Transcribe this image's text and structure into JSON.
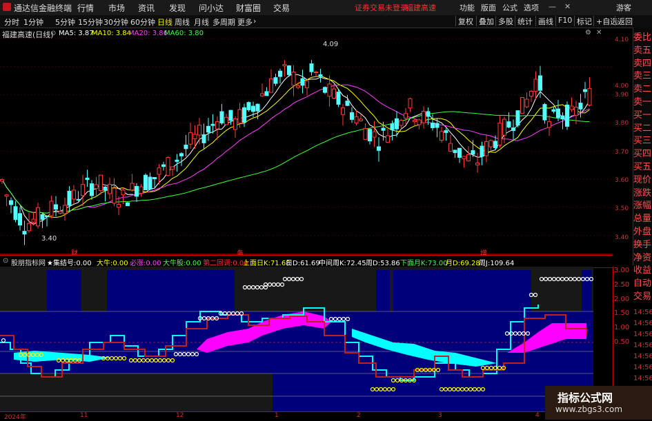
{
  "app": {
    "title": "通达信金融终端",
    "alert1": "证券交易未登录",
    "alert2": "福建高速"
  },
  "menu": [
    "行情",
    "市场",
    "资讯",
    "发现",
    "问小达",
    "财富圈",
    "交易"
  ],
  "sysbtns": [
    "功能",
    "版面",
    "公式",
    "选项",
    "游客"
  ],
  "periods": [
    "分时",
    "1分钟",
    "5分钟",
    "15分钟",
    "30分钟",
    "60分钟",
    "日线",
    "周线",
    "月线",
    "多周期",
    "更多"
  ],
  "active_period": "日线",
  "right_tools": [
    "复权",
    "叠加",
    "多股",
    "统计",
    "画线",
    "F10",
    "标记",
    "+自选",
    "返回"
  ],
  "stock": {
    "name": "福建高速(日线)",
    "ma5": "MA5: 3.87",
    "ma10": "MA10: 3.84",
    "ma20": "MA20: 3.86",
    "ma60": "MA60: 3.80",
    "high": "4.09",
    "low": "3.40"
  },
  "colors": {
    "up": "#ff3b3b",
    "down": "#54ffff",
    "ma5": "#ffffff",
    "ma10": "#ffff00",
    "ma20": "#ff40ff",
    "ma60": "#40ff40"
  },
  "price_ticks": [
    "4.10",
    "4.00",
    "3.90",
    "3.80",
    "3.70",
    "3.60",
    "3.50",
    "3.40"
  ],
  "events": [
    "财",
    "务",
    "增"
  ],
  "right_panel": [
    "委比",
    "卖五",
    "卖四",
    "卖三",
    "卖二",
    "卖一",
    "买一",
    "买二",
    "买三",
    "买四",
    "买五",
    "现价",
    "涨跌",
    "涨幅",
    "总量",
    "外盘",
    "换手",
    "净资",
    "收益",
    "自动",
    "交易"
  ],
  "indicator": {
    "name": "股朋指标网",
    "items": [
      {
        "k": "★集结号:",
        "v": "0.00",
        "c": "#ffffff"
      },
      {
        "k": "大牛:",
        "v": "0.00",
        "c": "#ffff00"
      },
      {
        "k": "必涨:",
        "v": "0.00",
        "c": "#ff40ff"
      },
      {
        "k": "大牛股:",
        "v": "0.00",
        "c": "#40ff40"
      },
      {
        "k": "第二回调:",
        "v": "0.00",
        "c": "#ff3030"
      },
      {
        "k": "上面日K:",
        "v": "71.68",
        "c": "#ffff00"
      },
      {
        "k": "日D:",
        "v": "61.69",
        "c": "#ffffff"
      },
      {
        "k": "中间周K:",
        "v": "72.45",
        "c": "#ffffff"
      },
      {
        "k": "周D:",
        "v": "53.86",
        "c": "#ffffff"
      },
      {
        "k": "下面月K:",
        "v": "73.00",
        "c": "#40ff40"
      },
      {
        "k": "月D:",
        "v": "69.28",
        "c": "#ffff00"
      },
      {
        "k": "周J:",
        "v": "109.64",
        "c": "#ffffff"
      }
    ]
  },
  "ind_ticks": [
    "3.00",
    "2.50",
    "2.00",
    "1.50",
    "1.00",
    "0.50"
  ],
  "ind_right_ticks": [
    "14:56",
    "14:56",
    "14:56",
    "14:56",
    "14:56",
    "14:56",
    "14:56",
    "14:56",
    "14:56"
  ],
  "dates": [
    "2024年",
    "11",
    "12",
    "1",
    "2",
    "3",
    "4"
  ],
  "watermark": {
    "line1": "指标公式网",
    "line2": "www.zbgs3.com"
  }
}
